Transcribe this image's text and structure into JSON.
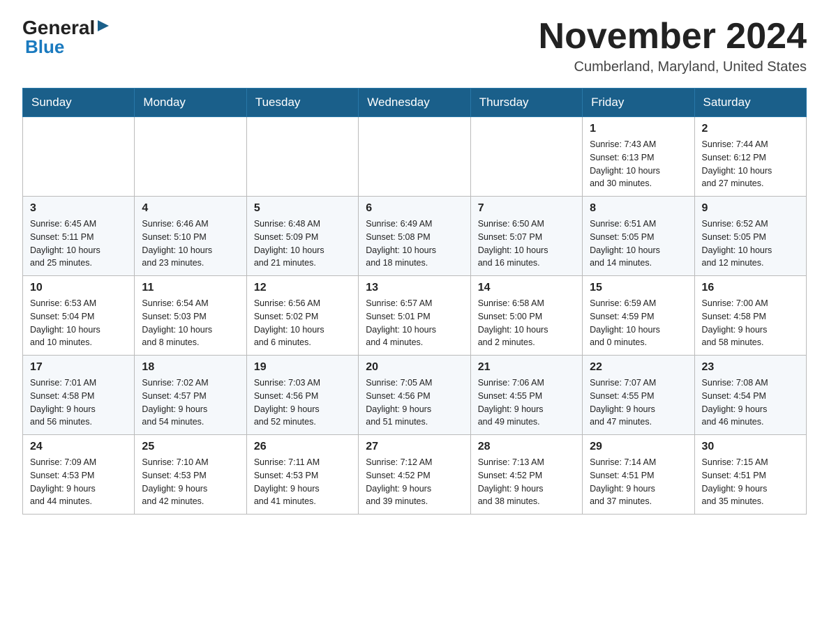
{
  "header": {
    "logo_general": "General",
    "logo_blue": "Blue",
    "month_title": "November 2024",
    "location": "Cumberland, Maryland, United States"
  },
  "weekdays": [
    "Sunday",
    "Monday",
    "Tuesday",
    "Wednesday",
    "Thursday",
    "Friday",
    "Saturday"
  ],
  "weeks": [
    [
      {
        "day": "",
        "info": ""
      },
      {
        "day": "",
        "info": ""
      },
      {
        "day": "",
        "info": ""
      },
      {
        "day": "",
        "info": ""
      },
      {
        "day": "",
        "info": ""
      },
      {
        "day": "1",
        "info": "Sunrise: 7:43 AM\nSunset: 6:13 PM\nDaylight: 10 hours\nand 30 minutes."
      },
      {
        "day": "2",
        "info": "Sunrise: 7:44 AM\nSunset: 6:12 PM\nDaylight: 10 hours\nand 27 minutes."
      }
    ],
    [
      {
        "day": "3",
        "info": "Sunrise: 6:45 AM\nSunset: 5:11 PM\nDaylight: 10 hours\nand 25 minutes."
      },
      {
        "day": "4",
        "info": "Sunrise: 6:46 AM\nSunset: 5:10 PM\nDaylight: 10 hours\nand 23 minutes."
      },
      {
        "day": "5",
        "info": "Sunrise: 6:48 AM\nSunset: 5:09 PM\nDaylight: 10 hours\nand 21 minutes."
      },
      {
        "day": "6",
        "info": "Sunrise: 6:49 AM\nSunset: 5:08 PM\nDaylight: 10 hours\nand 18 minutes."
      },
      {
        "day": "7",
        "info": "Sunrise: 6:50 AM\nSunset: 5:07 PM\nDaylight: 10 hours\nand 16 minutes."
      },
      {
        "day": "8",
        "info": "Sunrise: 6:51 AM\nSunset: 5:05 PM\nDaylight: 10 hours\nand 14 minutes."
      },
      {
        "day": "9",
        "info": "Sunrise: 6:52 AM\nSunset: 5:05 PM\nDaylight: 10 hours\nand 12 minutes."
      }
    ],
    [
      {
        "day": "10",
        "info": "Sunrise: 6:53 AM\nSunset: 5:04 PM\nDaylight: 10 hours\nand 10 minutes."
      },
      {
        "day": "11",
        "info": "Sunrise: 6:54 AM\nSunset: 5:03 PM\nDaylight: 10 hours\nand 8 minutes."
      },
      {
        "day": "12",
        "info": "Sunrise: 6:56 AM\nSunset: 5:02 PM\nDaylight: 10 hours\nand 6 minutes."
      },
      {
        "day": "13",
        "info": "Sunrise: 6:57 AM\nSunset: 5:01 PM\nDaylight: 10 hours\nand 4 minutes."
      },
      {
        "day": "14",
        "info": "Sunrise: 6:58 AM\nSunset: 5:00 PM\nDaylight: 10 hours\nand 2 minutes."
      },
      {
        "day": "15",
        "info": "Sunrise: 6:59 AM\nSunset: 4:59 PM\nDaylight: 10 hours\nand 0 minutes."
      },
      {
        "day": "16",
        "info": "Sunrise: 7:00 AM\nSunset: 4:58 PM\nDaylight: 9 hours\nand 58 minutes."
      }
    ],
    [
      {
        "day": "17",
        "info": "Sunrise: 7:01 AM\nSunset: 4:58 PM\nDaylight: 9 hours\nand 56 minutes."
      },
      {
        "day": "18",
        "info": "Sunrise: 7:02 AM\nSunset: 4:57 PM\nDaylight: 9 hours\nand 54 minutes."
      },
      {
        "day": "19",
        "info": "Sunrise: 7:03 AM\nSunset: 4:56 PM\nDaylight: 9 hours\nand 52 minutes."
      },
      {
        "day": "20",
        "info": "Sunrise: 7:05 AM\nSunset: 4:56 PM\nDaylight: 9 hours\nand 51 minutes."
      },
      {
        "day": "21",
        "info": "Sunrise: 7:06 AM\nSunset: 4:55 PM\nDaylight: 9 hours\nand 49 minutes."
      },
      {
        "day": "22",
        "info": "Sunrise: 7:07 AM\nSunset: 4:55 PM\nDaylight: 9 hours\nand 47 minutes."
      },
      {
        "day": "23",
        "info": "Sunrise: 7:08 AM\nSunset: 4:54 PM\nDaylight: 9 hours\nand 46 minutes."
      }
    ],
    [
      {
        "day": "24",
        "info": "Sunrise: 7:09 AM\nSunset: 4:53 PM\nDaylight: 9 hours\nand 44 minutes."
      },
      {
        "day": "25",
        "info": "Sunrise: 7:10 AM\nSunset: 4:53 PM\nDaylight: 9 hours\nand 42 minutes."
      },
      {
        "day": "26",
        "info": "Sunrise: 7:11 AM\nSunset: 4:53 PM\nDaylight: 9 hours\nand 41 minutes."
      },
      {
        "day": "27",
        "info": "Sunrise: 7:12 AM\nSunset: 4:52 PM\nDaylight: 9 hours\nand 39 minutes."
      },
      {
        "day": "28",
        "info": "Sunrise: 7:13 AM\nSunset: 4:52 PM\nDaylight: 9 hours\nand 38 minutes."
      },
      {
        "day": "29",
        "info": "Sunrise: 7:14 AM\nSunset: 4:51 PM\nDaylight: 9 hours\nand 37 minutes."
      },
      {
        "day": "30",
        "info": "Sunrise: 7:15 AM\nSunset: 4:51 PM\nDaylight: 9 hours\nand 35 minutes."
      }
    ]
  ]
}
